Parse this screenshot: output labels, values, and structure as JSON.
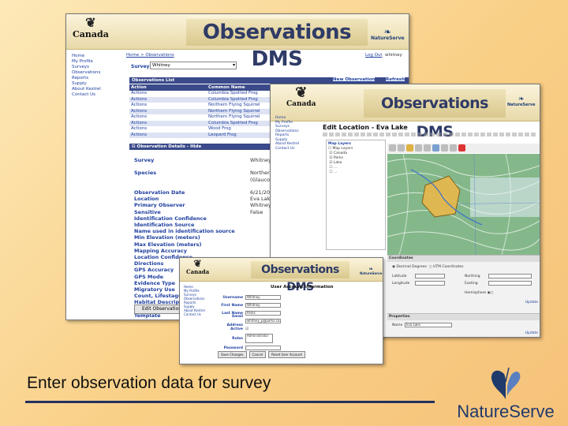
{
  "caption": "Enter observation data for survey",
  "logo": {
    "text": "NatureServe"
  },
  "window1": {
    "canada": "Canada",
    "banner": "Observations DMS",
    "brand": "NatureServe",
    "breadcrumb": "Home > Observations",
    "logout": "Log Out",
    "user": "whitney",
    "nav": [
      "Home",
      "My Profile",
      "Surveys",
      "Observations",
      "Reports",
      "Supply",
      "About Kestrel",
      "Contact Us"
    ],
    "survey_label": "Survey",
    "survey_value": "Whitney",
    "list_title": "Observations List",
    "new_obs": "New Observation",
    "refresh": "Refresh",
    "col_action": "Action",
    "col_name": "Common Name",
    "rows": [
      {
        "action": "Actions",
        "name": "Columbia Spotted Frog"
      },
      {
        "action": "Actions",
        "name": "Columbia Spotted Frog"
      },
      {
        "action": "Actions",
        "name": "Northern Flying Squirrel"
      },
      {
        "action": "Actions",
        "name": "Northern Flying Squirrel"
      },
      {
        "action": "Actions",
        "name": "Northern Flying Squirrel"
      },
      {
        "action": "Actions",
        "name": "Columbia Spotted Frog"
      },
      {
        "action": "Actions",
        "name": "Wood Frog"
      },
      {
        "action": "Actions",
        "name": "Leopard Frog"
      }
    ],
    "details_title": "Observation Details - Hide",
    "details_labels": [
      "Survey",
      "",
      "Species",
      "",
      "",
      "Observation Date",
      "Location",
      "Primary Observer",
      "Sensitive",
      "Identification Confidence",
      "Identification Source",
      "Name used in identification source",
      "Min Elevation (meters)",
      "Max Elevation (meters)",
      "Mapping Accuracy",
      "Location Confidence",
      "Directions",
      "GPS Accuracy",
      "GPS Mode",
      "Evidence Type",
      "Migratory Use",
      "Count, Lifestage",
      "Habitat Description",
      "",
      "Template"
    ],
    "details_values": [
      "Whitney",
      "",
      "Northern",
      "(Glaucomys",
      "",
      "6/21/20",
      "Eva Lak",
      "Whitney",
      "False"
    ],
    "edit_button": "Edit Observation"
  },
  "window2": {
    "canada": "Canada",
    "banner": "Observations DMS",
    "brand": "NatureServe",
    "nav": [
      "Home",
      "My Profile",
      "Surveys",
      "Observations",
      "Reports",
      "Supply",
      "About Kestrel",
      "Contact Us"
    ],
    "title": "Edit Location - Eva Lake",
    "layers_title": "Map Layers",
    "layers": [
      "Map Layers",
      "Canada",
      "Parks",
      "Lake",
      "...",
      "..."
    ],
    "coords_title": "Coordinates",
    "coord_fields": [
      "Latitude",
      "Longitude",
      "Northing",
      "Easting"
    ],
    "coord_radio": "Decimal Degrees",
    "utm_radio": "UTM Coordinates",
    "hemisphere": "Hemisphere",
    "update": "Update",
    "properties_title": "Properties",
    "name_label": "Name",
    "name_value": "Eva Lake"
  },
  "window3": {
    "canada": "Canada",
    "banner": "Observations DMS",
    "brand": "NatureServe",
    "nav": [
      "Home",
      "My Profile",
      "Surveys",
      "Observations",
      "Reports",
      "Supply",
      "About Kestrel",
      "Contact Us"
    ],
    "heading": "User Account Information",
    "fields": [
      {
        "label": "Username",
        "value": "Whitney"
      },
      {
        "label": "First Name",
        "value": "Whitney"
      },
      {
        "label": "Last Name",
        "value": "Parks"
      },
      {
        "label": "Email Address",
        "value": "whitney_p@parks.ca"
      },
      {
        "label": "Active",
        "value": ""
      },
      {
        "label": "Roles",
        "value": "Administrator"
      },
      {
        "label": "Password",
        "value": ""
      }
    ],
    "buttons": [
      "Save Changes",
      "Cancel",
      "Reset User Account"
    ]
  }
}
